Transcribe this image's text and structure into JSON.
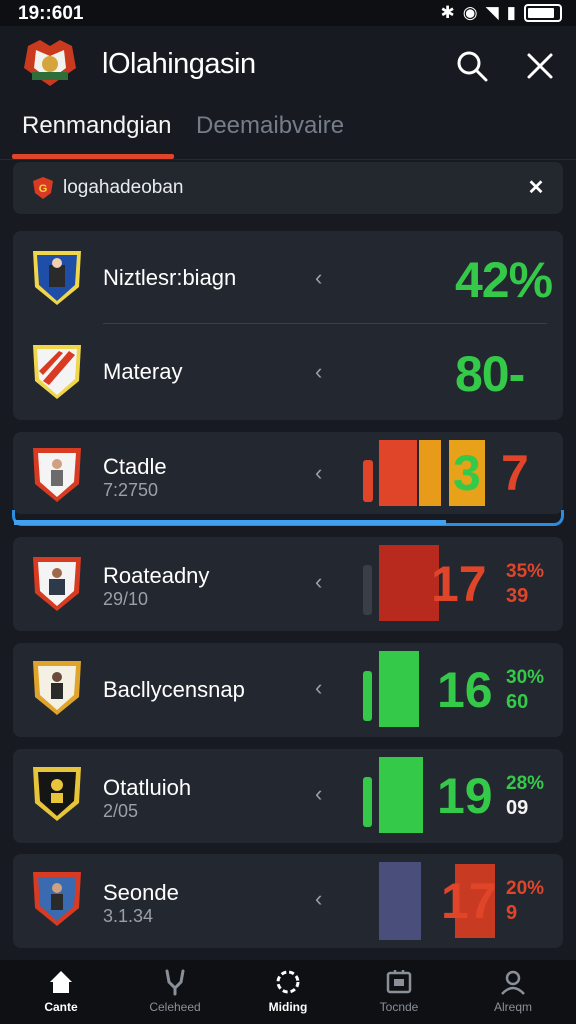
{
  "status": {
    "time": "19::601"
  },
  "header": {
    "title": "lOlahingasin"
  },
  "tabs": [
    {
      "label": "Renmandgian"
    },
    {
      "label": "Deemaibvaire"
    }
  ],
  "banner": {
    "text": "logahadeoban",
    "close_glyph": "✕"
  },
  "rows": [
    {
      "name": "Niztlesr:biagn",
      "sub": "",
      "value": "42%",
      "value_color": "#35c94a",
      "small_pct": "",
      "small_val": "",
      "small_color": ""
    },
    {
      "name": "Materay",
      "sub": "",
      "value": "80-",
      "value_color": "#35c94a",
      "small_pct": "",
      "small_val": "",
      "small_color": ""
    },
    {
      "name": "Ctadle",
      "sub": "7:2750",
      "value": "3",
      "value_color": "#35c94a",
      "value2": "7",
      "value2_color": "#e0452a",
      "small_pct": "",
      "small_val": "",
      "small_color": ""
    },
    {
      "name": "Roateadny",
      "sub": "29/10",
      "value": "17",
      "value_color": "#e0452a",
      "small_pct": "35%",
      "small_val": "39",
      "small_color": "#e0452a"
    },
    {
      "name": "Bacllycensnap",
      "sub": "",
      "value": "16",
      "value_color": "#35c94a",
      "small_pct": "30%",
      "small_val": "60",
      "small_color": "#35c94a"
    },
    {
      "name": "Otatluioh",
      "sub": "2/05",
      "value": "19",
      "value_color": "#35c94a",
      "small_pct": "28%",
      "small_val": "09",
      "small_color": "#35c94a"
    },
    {
      "name": "Seonde",
      "sub": "3.1.34",
      "value": "17",
      "value_color": "#e0452a",
      "small_pct": "20%",
      "small_val": "9",
      "small_color": "#e0452a"
    }
  ],
  "nav": [
    {
      "label": "Cante",
      "icon": "home-icon"
    },
    {
      "label": "Celeheed",
      "icon": "sling-icon"
    },
    {
      "label": "Miding",
      "icon": "ring-icon"
    },
    {
      "label": "Tocnde",
      "icon": "board-icon"
    },
    {
      "label": "Alreqm",
      "icon": "profile-icon"
    }
  ],
  "colors": {
    "accent_red": "#e0452a",
    "accent_green": "#35c94a",
    "accent_blue": "#41a0f0",
    "background": "#171b21",
    "card": "#232830"
  }
}
